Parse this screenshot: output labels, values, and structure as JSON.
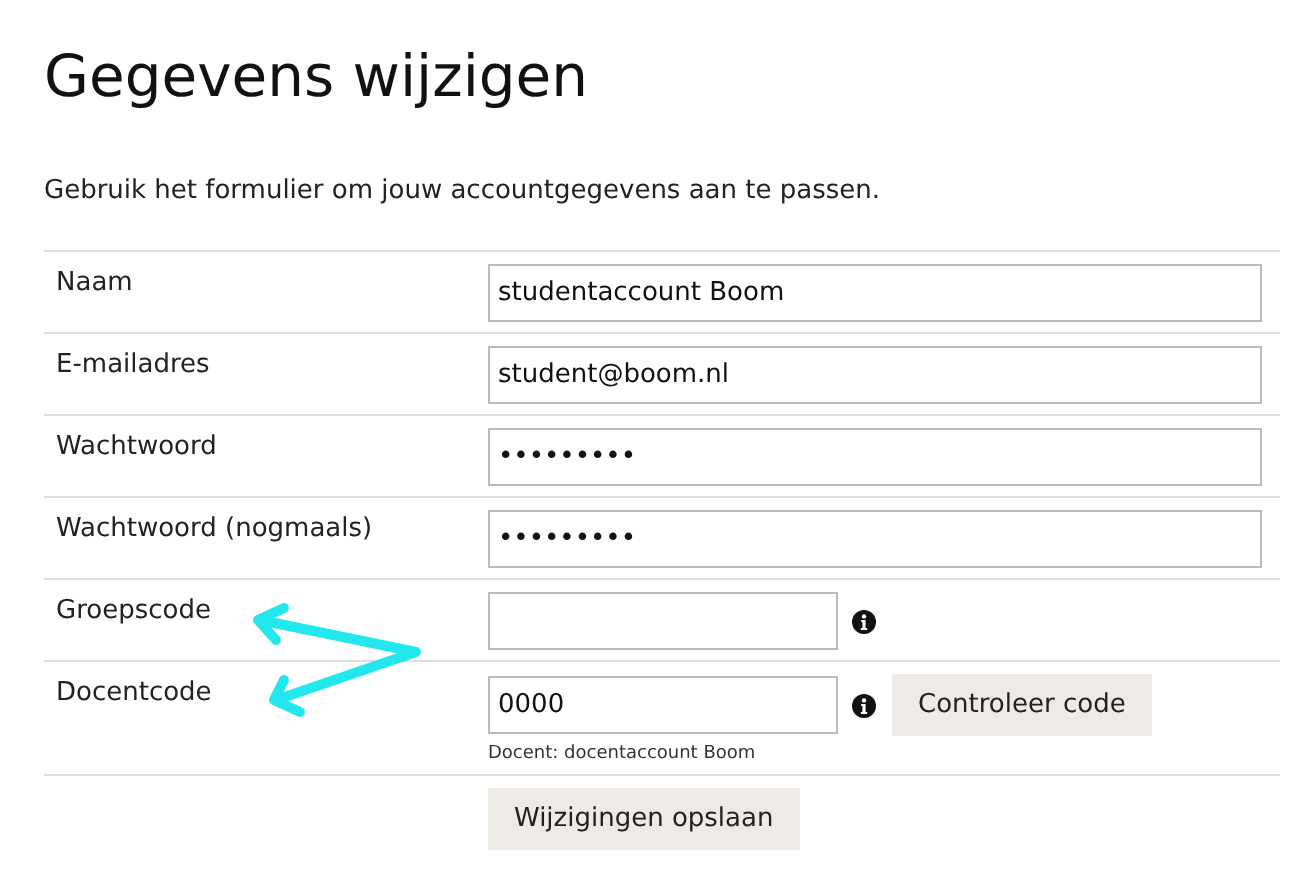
{
  "title": "Gegevens wijzigen",
  "intro": "Gebruik het formulier om jouw accountgegevens aan te passen.",
  "fields": [
    {
      "kind": "wide",
      "label": "Naam",
      "value": "studentaccount Boom"
    },
    {
      "kind": "wide",
      "label": "E-mailadres",
      "value": "student@boom.nl"
    },
    {
      "kind": "wide",
      "label": "Wachtwoord",
      "value": "•••••••••"
    },
    {
      "kind": "wide",
      "label": "Wachtwoord (nogmaals)",
      "value": "•••••••••"
    },
    {
      "kind": "short",
      "label": "Groepscode",
      "info": true
    },
    {
      "kind": "short",
      "label": "Docentcode",
      "value": "0000",
      "info": true,
      "button": "Controleer code",
      "note": "Docent: docentaccount Boom"
    }
  ],
  "submit": "Wijzigingen opslaan"
}
